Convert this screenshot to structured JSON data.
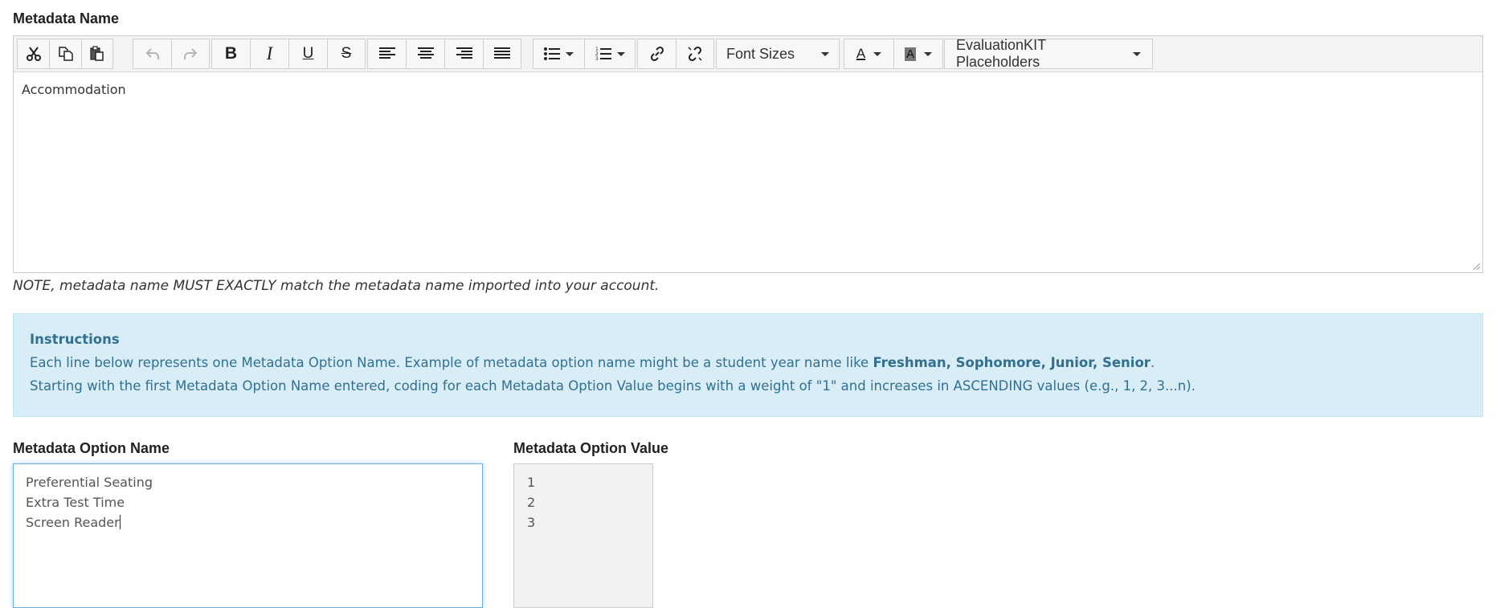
{
  "labels": {
    "metadata_name": "Metadata Name",
    "option_name": "Metadata Option Name",
    "option_value": "Metadata Option Value"
  },
  "toolbar": {
    "font_sizes": "Font Sizes",
    "placeholders": "EvaluationKIT Placeholders",
    "icons": [
      "cut-icon",
      "copy-icon",
      "paste-icon",
      "undo-icon",
      "redo-icon",
      "bold-icon",
      "italic-icon",
      "underline-icon",
      "strikethrough-icon",
      "align-left-icon",
      "align-center-icon",
      "align-right-icon",
      "justify-icon",
      "bullet-list-icon",
      "numbered-list-icon",
      "link-icon",
      "unlink-icon",
      "font-color-icon",
      "background-color-icon"
    ]
  },
  "editor": {
    "content": "Accommodation"
  },
  "note": "NOTE, metadata name MUST EXACTLY match the metadata name imported into your account.",
  "instructions": {
    "title": "Instructions",
    "line1_prefix": "Each line below represents one Metadata Option Name. Example of metadata option name might be a student year name like ",
    "line1_bold": "Freshman, Sophomore, Junior, Senior",
    "line1_suffix": ".",
    "line2": "Starting with the first Metadata Option Name entered, coding for each Metadata Option Value begins with a weight of \"1\" and increases in ASCENDING values (e.g., 1, 2, 3...n)."
  },
  "option_names": [
    "Preferential Seating",
    "Extra Test Time",
    "Screen Reader"
  ],
  "option_values": [
    "1",
    "2",
    "3"
  ],
  "colors": {
    "info_bg": "#d9edf7",
    "info_text": "#31708f",
    "focus_border": "#66afe9"
  }
}
